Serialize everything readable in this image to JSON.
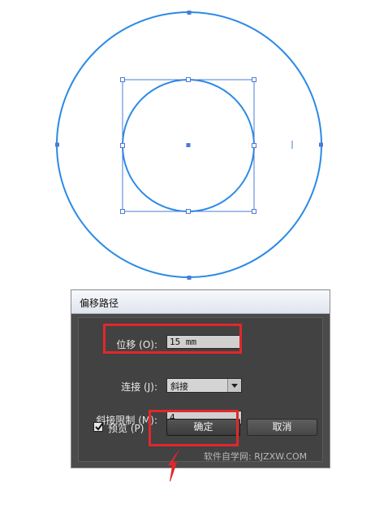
{
  "dialog": {
    "title": "偏移路径",
    "offset": {
      "label": "位移 (O):",
      "value": "15 mm"
    },
    "join": {
      "label": "连接 (J):",
      "selected": "斜接"
    },
    "miter_limit": {
      "label": "斜接限制 (M):",
      "value": "4"
    },
    "preview": {
      "label": "预览 (P)",
      "checked": true
    },
    "ok_label": "确定",
    "cancel_label": "取消"
  },
  "watermark": "软件自学网: RJZXW.COM",
  "colors": {
    "circle_stroke": "#2b8ae6",
    "selection": "#4a7bd8",
    "highlight": "#e0282b"
  }
}
